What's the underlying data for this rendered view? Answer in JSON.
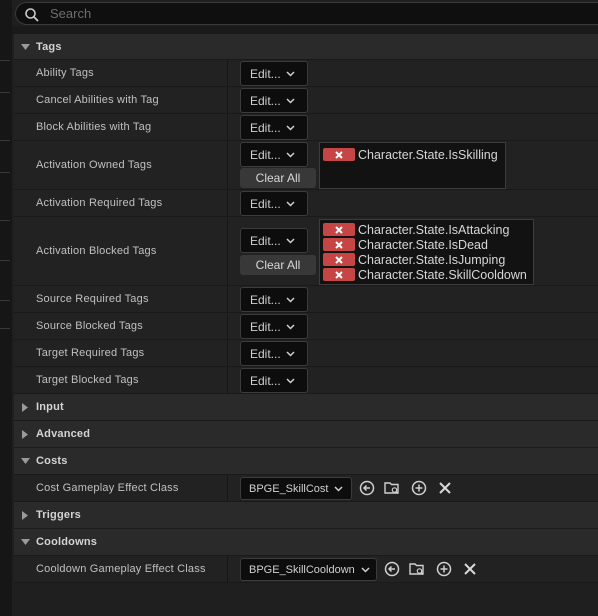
{
  "search": {
    "placeholder": "Search"
  },
  "edit_label": "Edit...",
  "clear_all_label": "Clear All",
  "tags_section": {
    "title": "Tags",
    "ability_tags": "Ability Tags",
    "cancel_abilities": "Cancel Abilities with Tag",
    "block_abilities": "Block Abilities with Tag",
    "activation_owned": "Activation Owned Tags",
    "activation_owned_tags": [
      "Character.State.IsSkilling"
    ],
    "activation_required": "Activation Required Tags",
    "activation_blocked": "Activation Blocked Tags",
    "activation_blocked_tags": [
      "Character.State.IsAttacking",
      "Character.State.IsDead",
      "Character.State.IsJumping",
      "Character.State.SkillCooldown"
    ],
    "source_required": "Source Required Tags",
    "source_blocked": "Source Blocked Tags",
    "target_required": "Target Required Tags",
    "target_blocked": "Target Blocked Tags"
  },
  "input_section": {
    "title": "Input"
  },
  "advanced_section": {
    "title": "Advanced"
  },
  "costs_section": {
    "title": "Costs",
    "cost_effect_label": "Cost Gameplay Effect Class",
    "cost_effect_value": "BPGE_SkillCost"
  },
  "triggers_section": {
    "title": "Triggers"
  },
  "cooldowns_section": {
    "title": "Cooldowns",
    "cooldown_effect_label": "Cooldown Gameplay Effect Class",
    "cooldown_effect_value": "BPGE_SkillCooldown"
  },
  "colors": {
    "tag_remove": "#c64545",
    "background": "#1f1f1f",
    "category": "#2a2a2a"
  }
}
